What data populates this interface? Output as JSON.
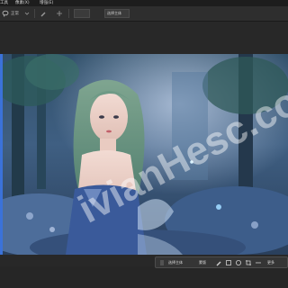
{
  "menubar": {
    "items": [
      {
        "label": "工具"
      },
      {
        "label": "像素(X)"
      },
      {
        "label": "增强(E)"
      }
    ]
  },
  "options_bar": {
    "mode_label": "正常",
    "selected_label": "选择主体",
    "sample_value": "调整边缘"
  },
  "canvas": {
    "watermark": "ivianHesc.com"
  },
  "context_bar": {
    "select_subject_label": "选择主体",
    "mask_label": "蒙版",
    "more_label": "更多"
  },
  "icons": {
    "move": "move-icon",
    "brush": "brush-icon",
    "lasso": "lasso-icon"
  },
  "colors": {
    "selection_edge": "#3b72d9",
    "panel": "#2e2e2e"
  }
}
